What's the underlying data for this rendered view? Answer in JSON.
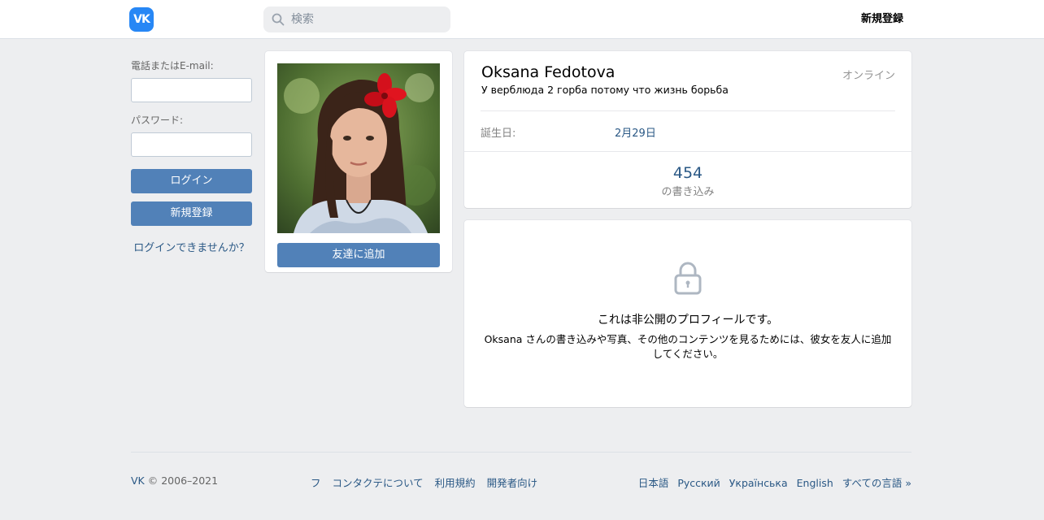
{
  "header": {
    "logo_text": "VK",
    "search_placeholder": "検索",
    "signup_label": "新規登録"
  },
  "login": {
    "email_label": "電話またはE-mail:",
    "password_label": "パスワード:",
    "login_button": "ログイン",
    "signup_button": "新規登録",
    "forgot_link": "ログインできませんか？"
  },
  "profile": {
    "add_friend_button": "友達に追加",
    "name": "Oksana Fedotova",
    "online_status": "オンライン",
    "status_text": "У верблюда 2 горба потому что жизнь борьба",
    "birthday_label": "誕生日:",
    "birthday_value": "2月29日",
    "posts_count": "454",
    "posts_label": "の書き込み"
  },
  "private": {
    "title": "これは非公開のプロフィールです。",
    "text": "Oksana さんの書き込みや写真、その他のコンテンツを見るためには、彼女を友人に追加してください。"
  },
  "footer": {
    "copyright_vk": "VK",
    "copyright_years": "© 2006–2021",
    "links": [
      "フ",
      "コンタクテについて",
      "利用規約",
      "開発者向け"
    ],
    "languages": [
      "日本語",
      "Русский",
      "Українська",
      "English",
      "すべての言語 »"
    ]
  },
  "colors": {
    "accent": "#5181b8",
    "link": "#2a5885",
    "background": "#edeef0",
    "logo": "#2787f5"
  }
}
